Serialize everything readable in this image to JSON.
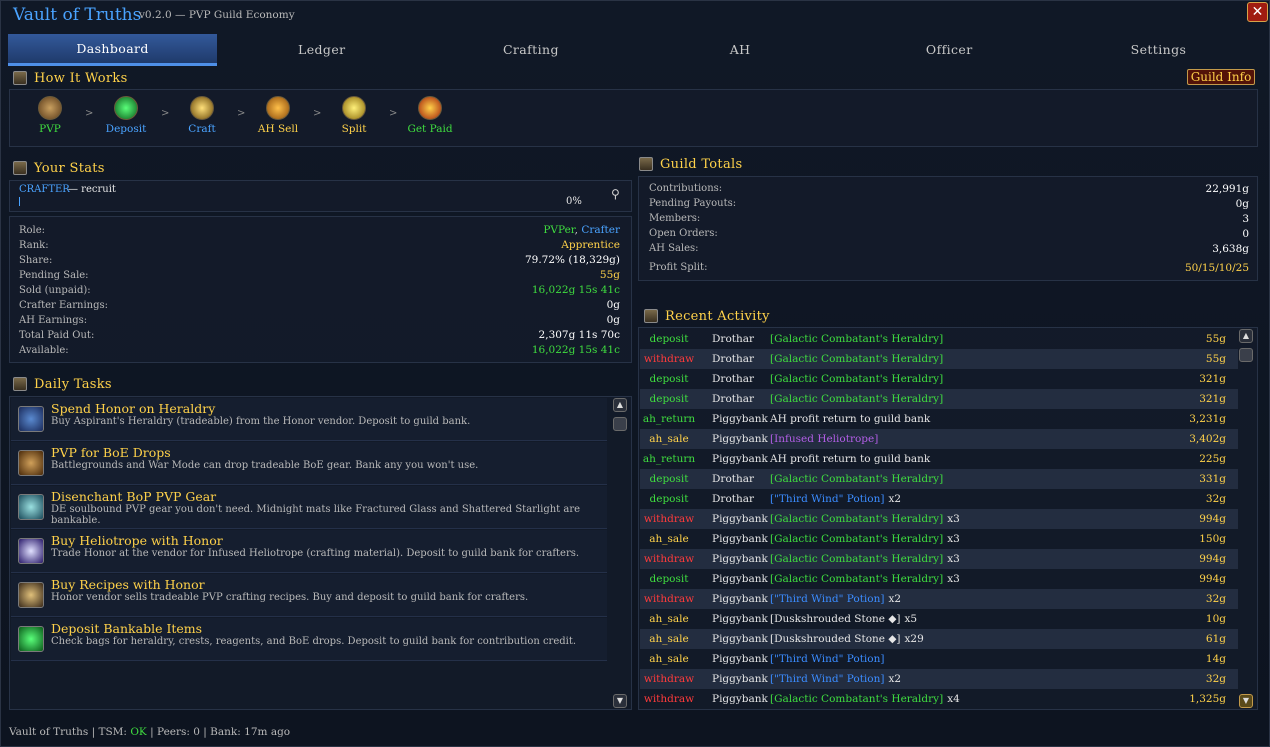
{
  "app": {
    "title": "Vault of Truths",
    "subtitle": "v0.2.0 — PVP Guild Economy"
  },
  "tabs": [
    {
      "label": "Dashboard",
      "active": true
    },
    {
      "label": "Ledger"
    },
    {
      "label": "Crafting"
    },
    {
      "label": "AH"
    },
    {
      "label": "Officer"
    },
    {
      "label": "Settings"
    }
  ],
  "how_it_works": {
    "title": "How It Works",
    "guild_info": "Guild Info",
    "steps": [
      {
        "label": "PVP",
        "color": "#3fdc3f"
      },
      {
        "label": "Deposit",
        "color": "#4aa3ff"
      },
      {
        "label": "Craft",
        "color": "#4aa3ff"
      },
      {
        "label": "AH Sell",
        "color": "#ffd24a"
      },
      {
        "label": "Split",
        "color": "#ffd24a"
      },
      {
        "label": "Get Paid",
        "color": "#3fdc3f"
      }
    ],
    "arrow": ">"
  },
  "your_stats": {
    "title": "Your Stats",
    "role_line": "CRAFTER",
    "rank_line": "— recruit",
    "progress": "0%",
    "rows": [
      {
        "label": "Role:",
        "value_a": "PVPer",
        "sep": ",",
        "value_b": "Crafter"
      },
      {
        "label": "Rank:",
        "value": "Apprentice",
        "color": "#ffd24a"
      },
      {
        "label": "Share:",
        "value": "79.72% (18,329g)",
        "color": "#ffffff"
      },
      {
        "label": "Pending Sale:",
        "value": "55g",
        "color": "#ffd24a"
      },
      {
        "label": "Sold (unpaid):",
        "value": "16,022g 15s 41c",
        "color": "#3fdc3f"
      },
      {
        "label": "Crafter Earnings:",
        "value": "0g",
        "color": "#ffffff"
      },
      {
        "label": "AH Earnings:",
        "value": "0g",
        "color": "#ffffff"
      },
      {
        "label": "Total Paid Out:",
        "value": "2,307g 11s 70c",
        "color": "#ffffff"
      },
      {
        "label": "Available:",
        "value": "16,022g 15s 41c",
        "color": "#3fdc3f"
      }
    ]
  },
  "daily_tasks": {
    "title": "Daily Tasks",
    "items": [
      {
        "title": "Spend Honor on Heraldry",
        "desc": "Buy Aspirant's Heraldry (tradeable) from the Honor vendor. Deposit to guild bank."
      },
      {
        "title": "PVP for BoE Drops",
        "desc": "Battlegrounds and War Mode can drop tradeable BoE gear. Bank any you won't use."
      },
      {
        "title": "Disenchant BoP PVP Gear",
        "desc": "DE soulbound PVP gear you don't need. Midnight mats like Fractured Glass and Shattered Starlight are bankable."
      },
      {
        "title": "Buy Heliotrope with Honor",
        "desc": "Trade Honor at the vendor for Infused Heliotrope (crafting material). Deposit to guild bank for crafters."
      },
      {
        "title": "Buy Recipes with Honor",
        "desc": "Honor vendor sells tradeable PVP crafting recipes. Buy and deposit to guild bank for crafters."
      },
      {
        "title": "Deposit Bankable Items",
        "desc": "Check bags for heraldry, crests, reagents, and BoE drops. Deposit to guild bank for contribution credit."
      }
    ]
  },
  "guild_totals": {
    "title": "Guild Totals",
    "rows": [
      {
        "label": "Contributions:",
        "value": "22,991g",
        "color": "#ffffff"
      },
      {
        "label": "Pending Payouts:",
        "value": "0g",
        "color": "#ffffff"
      },
      {
        "label": "Members:",
        "value": "3",
        "color": "#ffffff"
      },
      {
        "label": "Open Orders:",
        "value": "0",
        "color": "#ffffff"
      },
      {
        "label": "AH Sales:",
        "value": "3,638g",
        "color": "#ffffff"
      },
      {
        "label": "Profit Split:",
        "value": "50/15/10/25",
        "color": "#ffd24a"
      }
    ]
  },
  "recent_activity": {
    "title": "Recent Activity",
    "rows": [
      {
        "type": "deposit",
        "who": "Drothar",
        "item": "[Galactic Combatant's Heraldry]",
        "qty": "",
        "amount": "55g",
        "icolor": "#3fdc3f"
      },
      {
        "type": "withdraw",
        "who": "Drothar",
        "item": "[Galactic Combatant's Heraldry]",
        "qty": "",
        "amount": "55g",
        "icolor": "#3fdc3f"
      },
      {
        "type": "deposit",
        "who": "Drothar",
        "item": "[Galactic Combatant's Heraldry]",
        "qty": "",
        "amount": "321g",
        "icolor": "#3fdc3f"
      },
      {
        "type": "deposit",
        "who": "Drothar",
        "item": "[Galactic Combatant's Heraldry]",
        "qty": "",
        "amount": "321g",
        "icolor": "#3fdc3f"
      },
      {
        "type": "ah_return",
        "who": "Piggybank",
        "item": "AH profit return to guild bank",
        "qty": "",
        "amount": "3,231g",
        "icolor": "#e6e6e6"
      },
      {
        "type": "ah_sale",
        "who": "Piggybank",
        "item": "[Infused Heliotrope]",
        "qty": "",
        "amount": "3,402g",
        "icolor": "#b25ee6"
      },
      {
        "type": "ah_return",
        "who": "Piggybank",
        "item": "AH profit return to guild bank",
        "qty": "",
        "amount": "225g",
        "icolor": "#e6e6e6"
      },
      {
        "type": "deposit",
        "who": "Drothar",
        "item": "[Galactic Combatant's Heraldry]",
        "qty": "",
        "amount": "331g",
        "icolor": "#3fdc3f"
      },
      {
        "type": "deposit",
        "who": "Drothar",
        "item": "[\"Third Wind\" Potion]",
        "qty": "x2",
        "amount": "32g",
        "icolor": "#3b8cff"
      },
      {
        "type": "withdraw",
        "who": "Piggybank",
        "item": "[Galactic Combatant's Heraldry]",
        "qty": "x3",
        "amount": "994g",
        "icolor": "#3fdc3f"
      },
      {
        "type": "ah_sale",
        "who": "Piggybank",
        "item": "[Galactic Combatant's Heraldry]",
        "qty": "x3",
        "amount": "150g",
        "icolor": "#3fdc3f"
      },
      {
        "type": "withdraw",
        "who": "Piggybank",
        "item": "[Galactic Combatant's Heraldry]",
        "qty": "x3",
        "amount": "994g",
        "icolor": "#3fdc3f"
      },
      {
        "type": "deposit",
        "who": "Piggybank",
        "item": "[Galactic Combatant's Heraldry]",
        "qty": "x3",
        "amount": "994g",
        "icolor": "#3fdc3f"
      },
      {
        "type": "withdraw",
        "who": "Piggybank",
        "item": "[\"Third Wind\" Potion]",
        "qty": "x2",
        "amount": "32g",
        "icolor": "#3b8cff"
      },
      {
        "type": "ah_sale",
        "who": "Piggybank",
        "item": "[Duskshrouded Stone ◆]",
        "qty": "x5",
        "amount": "10g",
        "icolor": "#e6e6e6"
      },
      {
        "type": "ah_sale",
        "who": "Piggybank",
        "item": "[Duskshrouded Stone ◆]",
        "qty": "x29",
        "amount": "61g",
        "icolor": "#e6e6e6"
      },
      {
        "type": "ah_sale",
        "who": "Piggybank",
        "item": "[\"Third Wind\" Potion]",
        "qty": "",
        "amount": "14g",
        "icolor": "#3b8cff"
      },
      {
        "type": "withdraw",
        "who": "Piggybank",
        "item": "[\"Third Wind\" Potion]",
        "qty": "x2",
        "amount": "32g",
        "icolor": "#3b8cff"
      },
      {
        "type": "withdraw",
        "who": "Piggybank",
        "item": "[Galactic Combatant's Heraldry]",
        "qty": "x4",
        "amount": "1,325g",
        "icolor": "#3fdc3f"
      }
    ]
  },
  "footer": {
    "prefix": "Vault of Truths | TSM:",
    "tsm_status": "OK",
    "suffix": "| Peers: 0 | Bank: 17m ago"
  },
  "colors": {
    "deposit": "#3fdc3f",
    "withdraw": "#ff3b3b",
    "ah_return": "#3fdc3f",
    "ah_sale": "#ffd24a",
    "gold": "#ffd24a",
    "link_blue": "#4aa3ff"
  }
}
